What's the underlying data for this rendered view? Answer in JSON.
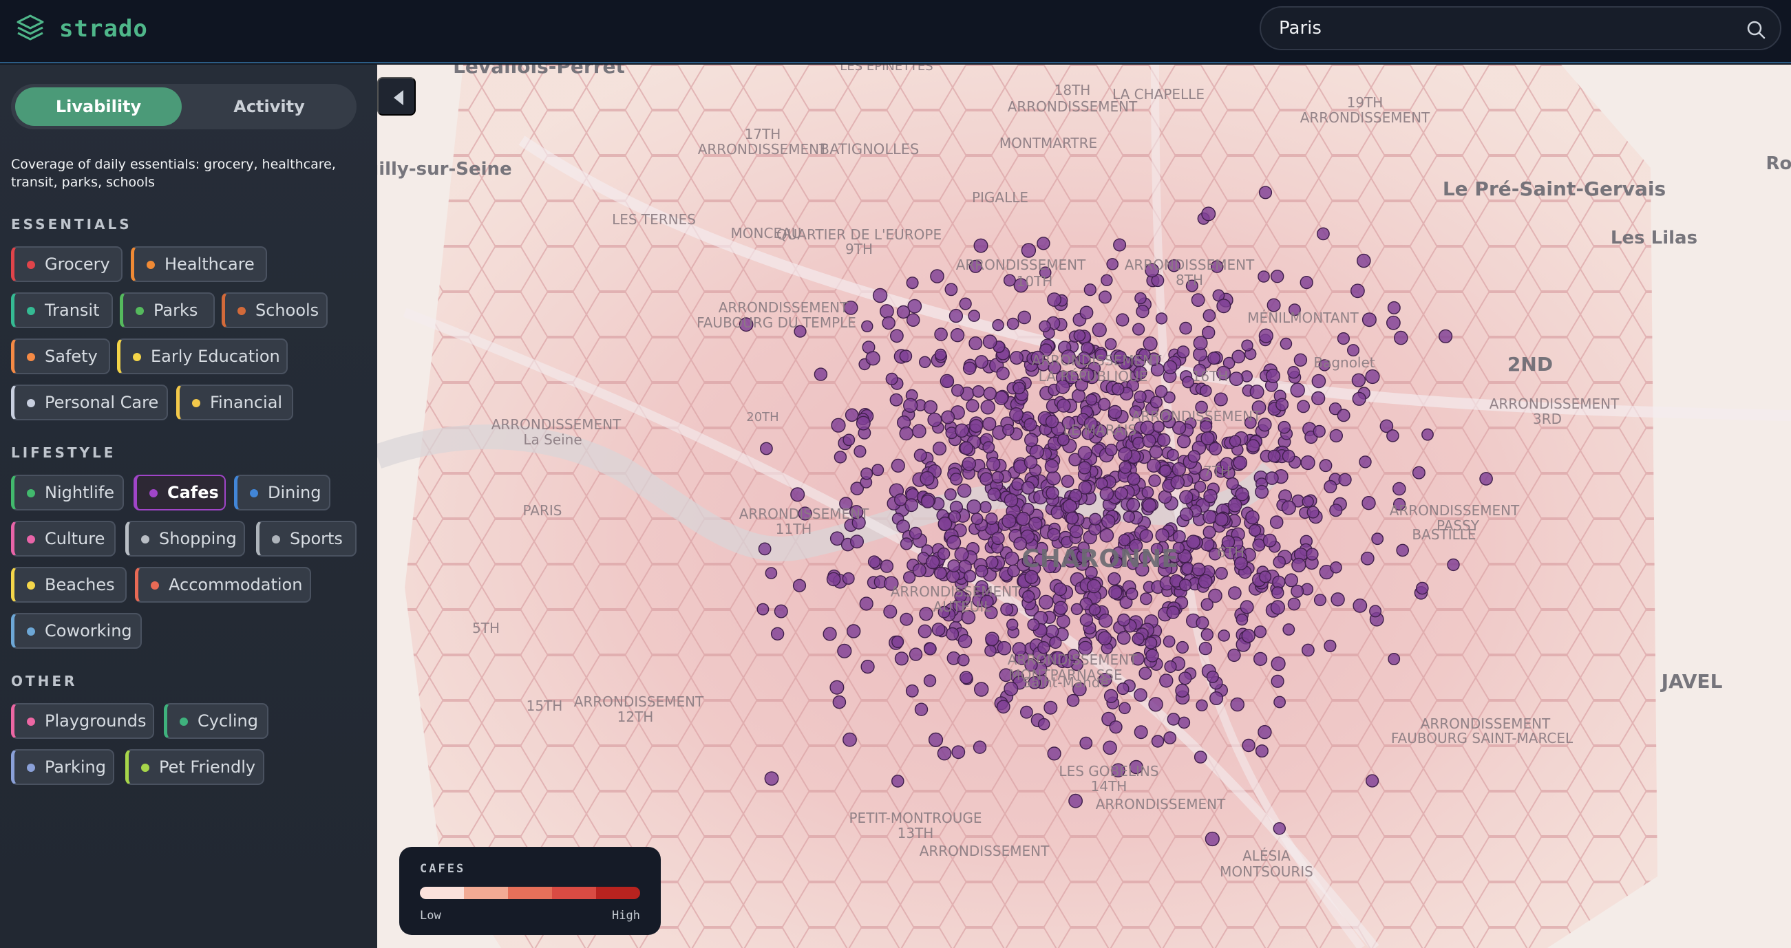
{
  "app": {
    "name": "strado"
  },
  "search": {
    "value": "Paris"
  },
  "mode_tabs": [
    {
      "label": "Livability"
    },
    {
      "label": "Activity"
    }
  ],
  "description": "Coverage of daily essentials: grocery, healthcare, transit, parks, schools",
  "sections": {
    "essentials": "ESSENTIALS",
    "lifestyle": "LIFESTYLE",
    "other": "OTHER"
  },
  "categories": {
    "essentials": [
      {
        "label": "Grocery",
        "color": "#e0444a"
      },
      {
        "label": "Healthcare",
        "color": "#f08a35"
      },
      {
        "label": "Transit",
        "color": "#35ba93"
      },
      {
        "label": "Parks",
        "color": "#55b95d"
      },
      {
        "label": "Schools",
        "color": "#d36a3a"
      },
      {
        "label": "Safety",
        "color": "#f58a45"
      },
      {
        "label": "Early Education",
        "color": "#f3d448"
      },
      {
        "label": "Personal Care",
        "color": "#c8cfdf"
      },
      {
        "label": "Financial",
        "color": "#f2c84a"
      }
    ],
    "lifestyle": [
      {
        "label": "Nightlife",
        "color": "#42b96d"
      },
      {
        "label": "Cafes",
        "color": "#a045c8",
        "selected": true
      },
      {
        "label": "Dining",
        "color": "#4286d8"
      },
      {
        "label": "Culture",
        "color": "#e864a8"
      },
      {
        "label": "Shopping",
        "color": "#b9bec5"
      },
      {
        "label": "Sports",
        "color": "#aeb4bb"
      },
      {
        "label": "Beaches",
        "color": "#f4d64a"
      },
      {
        "label": "Accommodation",
        "color": "#e86a55"
      },
      {
        "label": "Coworking",
        "color": "#6da7d6"
      }
    ],
    "other": [
      {
        "label": "Playgrounds",
        "color": "#ec67a3"
      },
      {
        "label": "Cycling",
        "color": "#3fb27d"
      },
      {
        "label": "Parking",
        "color": "#8aa0d8"
      },
      {
        "label": "Pet Friendly",
        "color": "#a7d64a"
      }
    ]
  },
  "legend": {
    "title": "CAFES",
    "low": "Low",
    "high": "High",
    "scale_colors": [
      "#fbe1db",
      "#f2aa94",
      "#e6705a",
      "#d94b43",
      "#b8231f"
    ]
  },
  "map_labels": [
    "Levallois-Perret",
    "LES EPINETTES",
    "18TH",
    "ARRONDISSEMENT",
    "LA CHAPELLE",
    "19TH",
    "ARRONDISSEMENT",
    "17TH",
    "ARRONDISSEMENT",
    "BATIGNOLLES",
    "MONTMARTRE",
    "Neuilly-sur-Seine",
    "PIGALLE",
    "Le Pré-Saint-Gervais",
    "Rom",
    "Les Lilas",
    "LES TERNES",
    "MONCEAU",
    "QUARTIER DE L'EUROPE",
    "9TH",
    "ARRONDISSEMENT",
    "10TH",
    "ARRONDISSEMENT",
    "8TH",
    "ARRONDISSEMENT",
    "FAUBOURG DU TEMPLE",
    "MÉNILMONTANT",
    "Bagnolet",
    "2ND",
    "ARRONDISSEMENT",
    "LA RÉPUBLIQUE",
    "16TH",
    "ARRONDISSEMENT",
    "La Seine",
    "20TH",
    "ARRONDISSEMENT",
    "3RD",
    "ARRONDISSEMENT",
    "LE MARAIS",
    "7TH",
    "ARRONDISSEMENT",
    "11TH",
    "ARRONDISSEMENT",
    "PASSY",
    "PARIS",
    "CHARONNE",
    "BASTILLE",
    "6TH",
    "ARRONDISSEMENT",
    "AUTEUIL",
    "5TH",
    "ARRONDISSEMENT",
    "MONTPARNASSE",
    "Saint-Mandé",
    "JAVEL",
    "15TH",
    "ARRONDISSEMENT",
    "12TH",
    "ARRONDISSEMENT",
    "FAUBOURG SAINT-MARCEL",
    "LES GOBELINS",
    "14TH",
    "ARRONDISSEMENT",
    "PETIT-MONTROUGE",
    "13TH",
    "ARRONDISSEMENT",
    "ALÉSIA",
    "MONTSOURIS"
  ]
}
